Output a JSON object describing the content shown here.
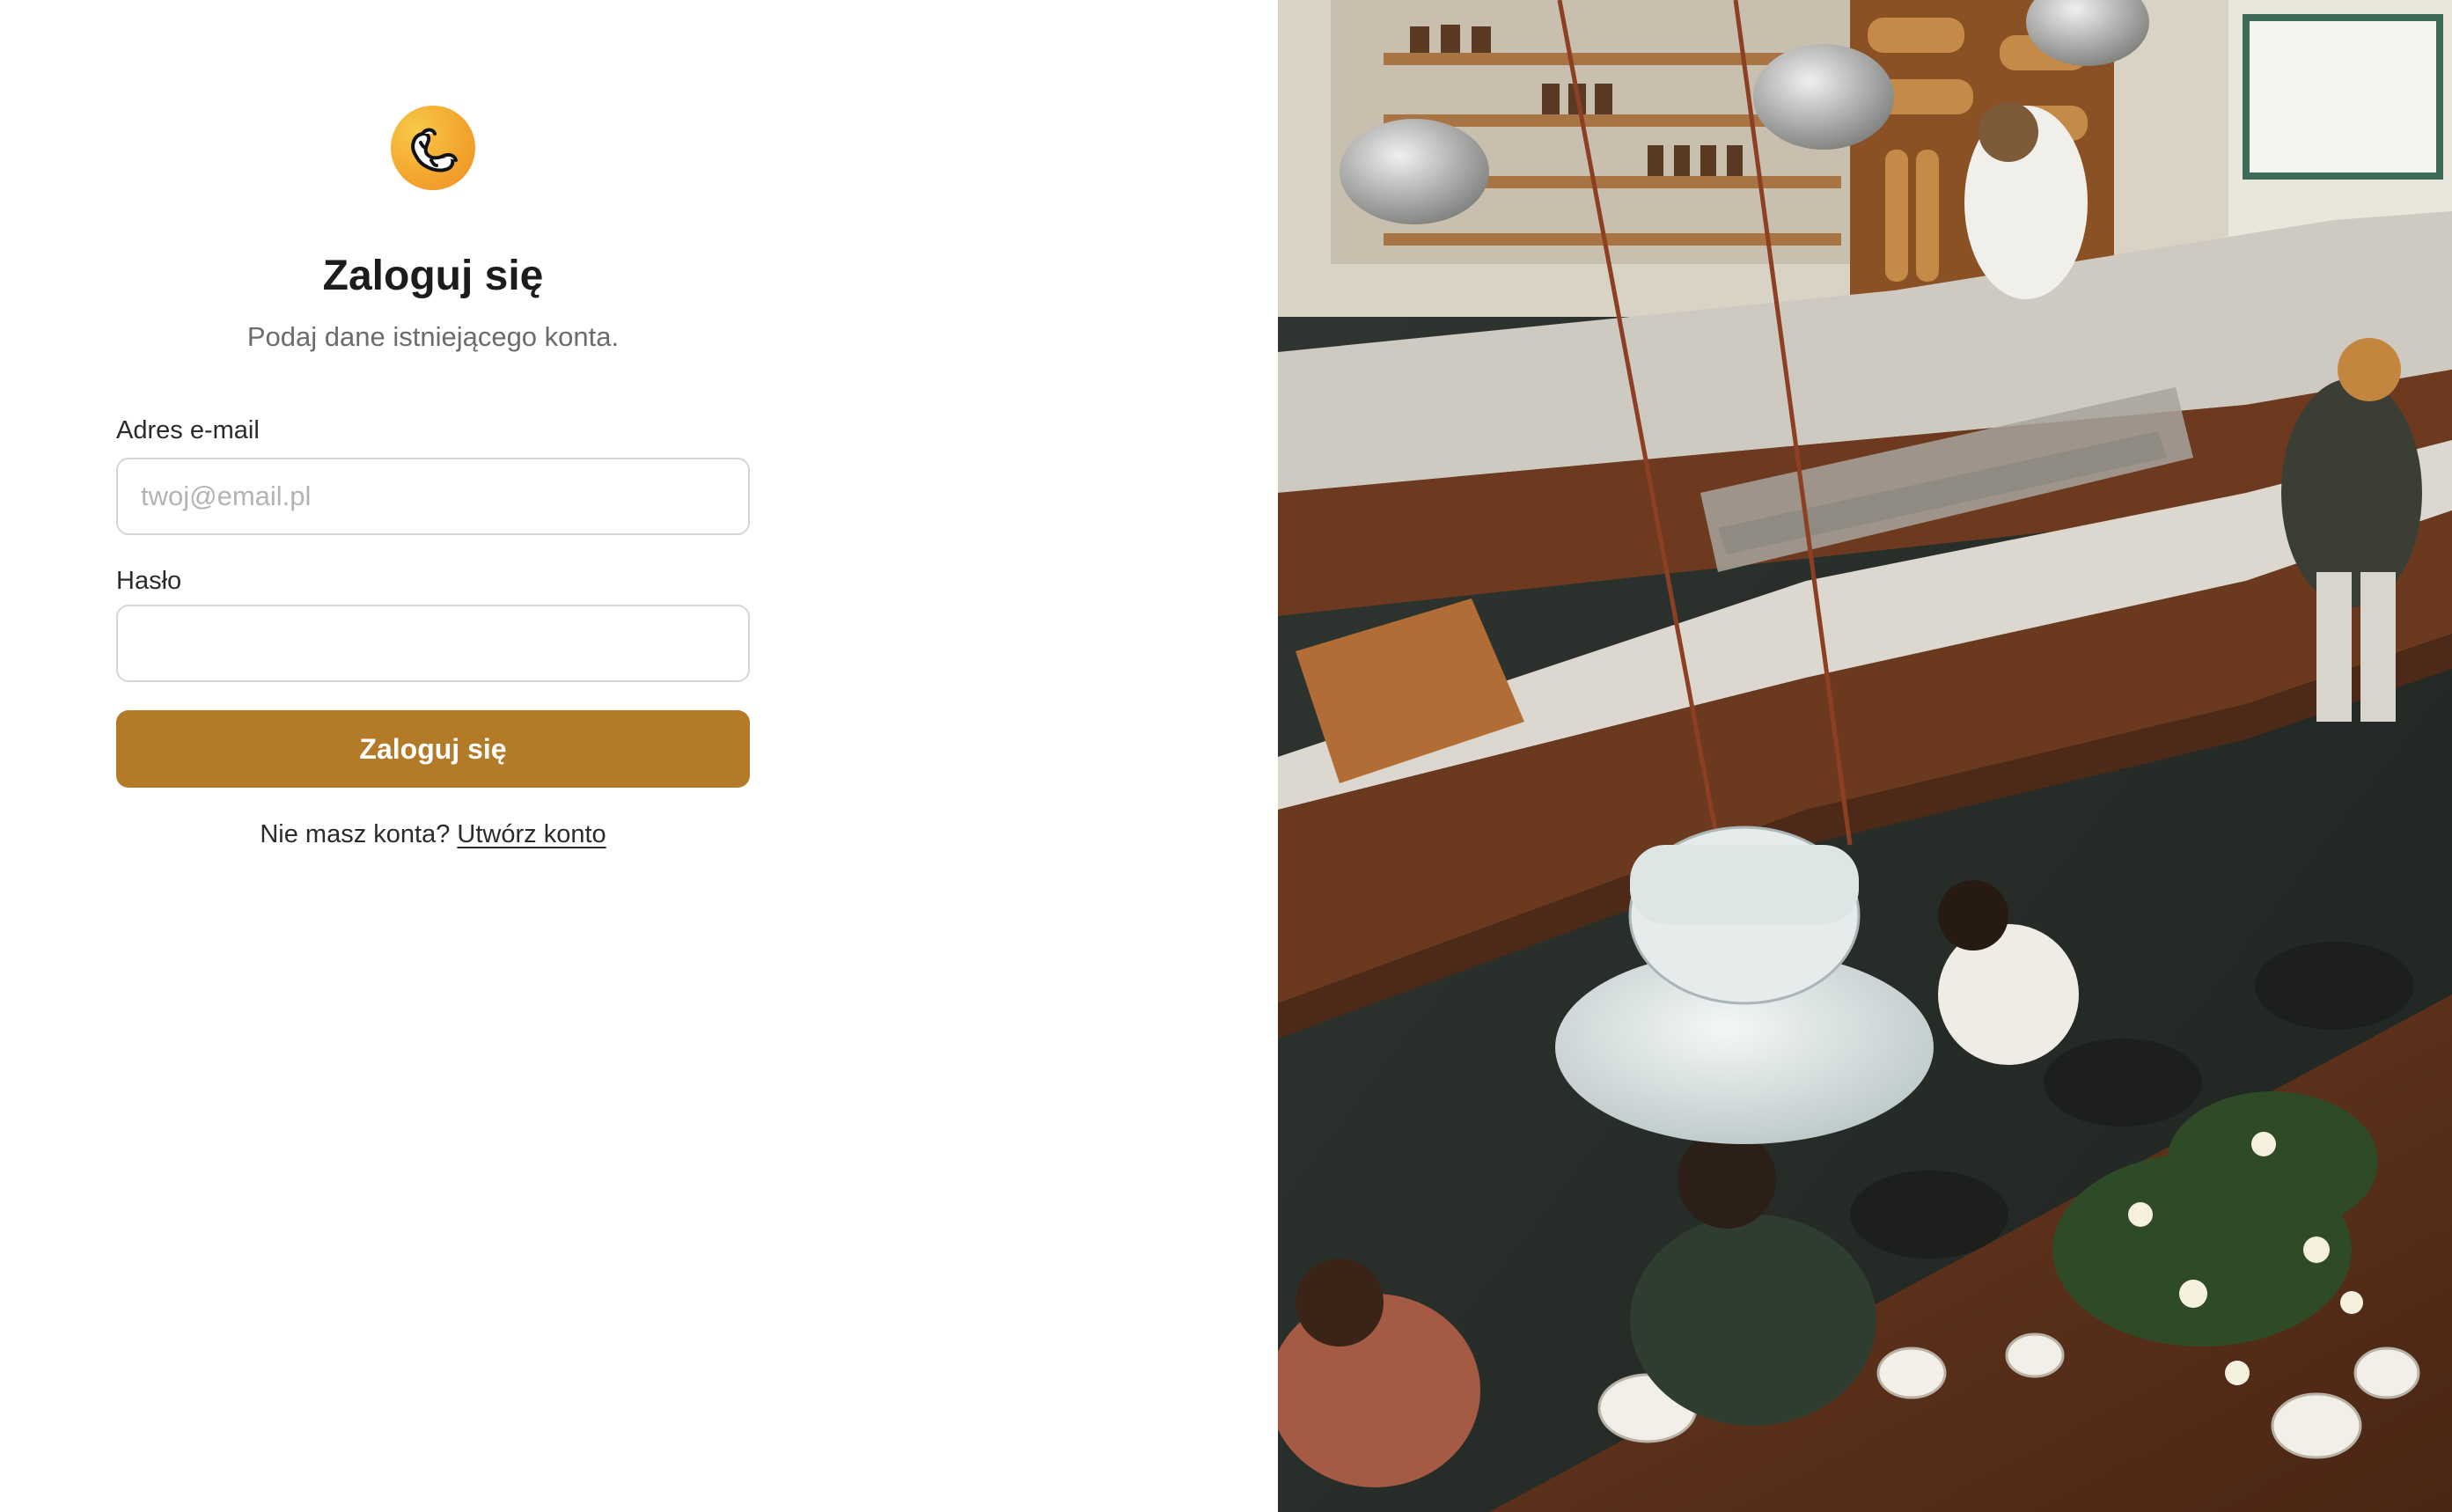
{
  "logo": {
    "icon": "croissant-icon",
    "gradient": [
      "#f8c94a",
      "#ee8e28"
    ]
  },
  "login": {
    "title": "Zaloguj się",
    "subtitle": "Podaj dane istniejącego konta.",
    "email_label": "Adres e-mail",
    "email_placeholder": "twoj@email.pl",
    "email_value": "",
    "password_label": "Hasło",
    "password_value": "",
    "submit_label": "Zaloguj się",
    "signup_prompt": "Nie masz konta?",
    "signup_link": "Utwórz konto"
  },
  "colors": {
    "accent": "#b37b27",
    "text": "#1c1c1e",
    "muted": "#6b6b70",
    "border": "#d6d6da"
  },
  "hero_image": {
    "subject": "bakery-cafe-interior-photo"
  }
}
